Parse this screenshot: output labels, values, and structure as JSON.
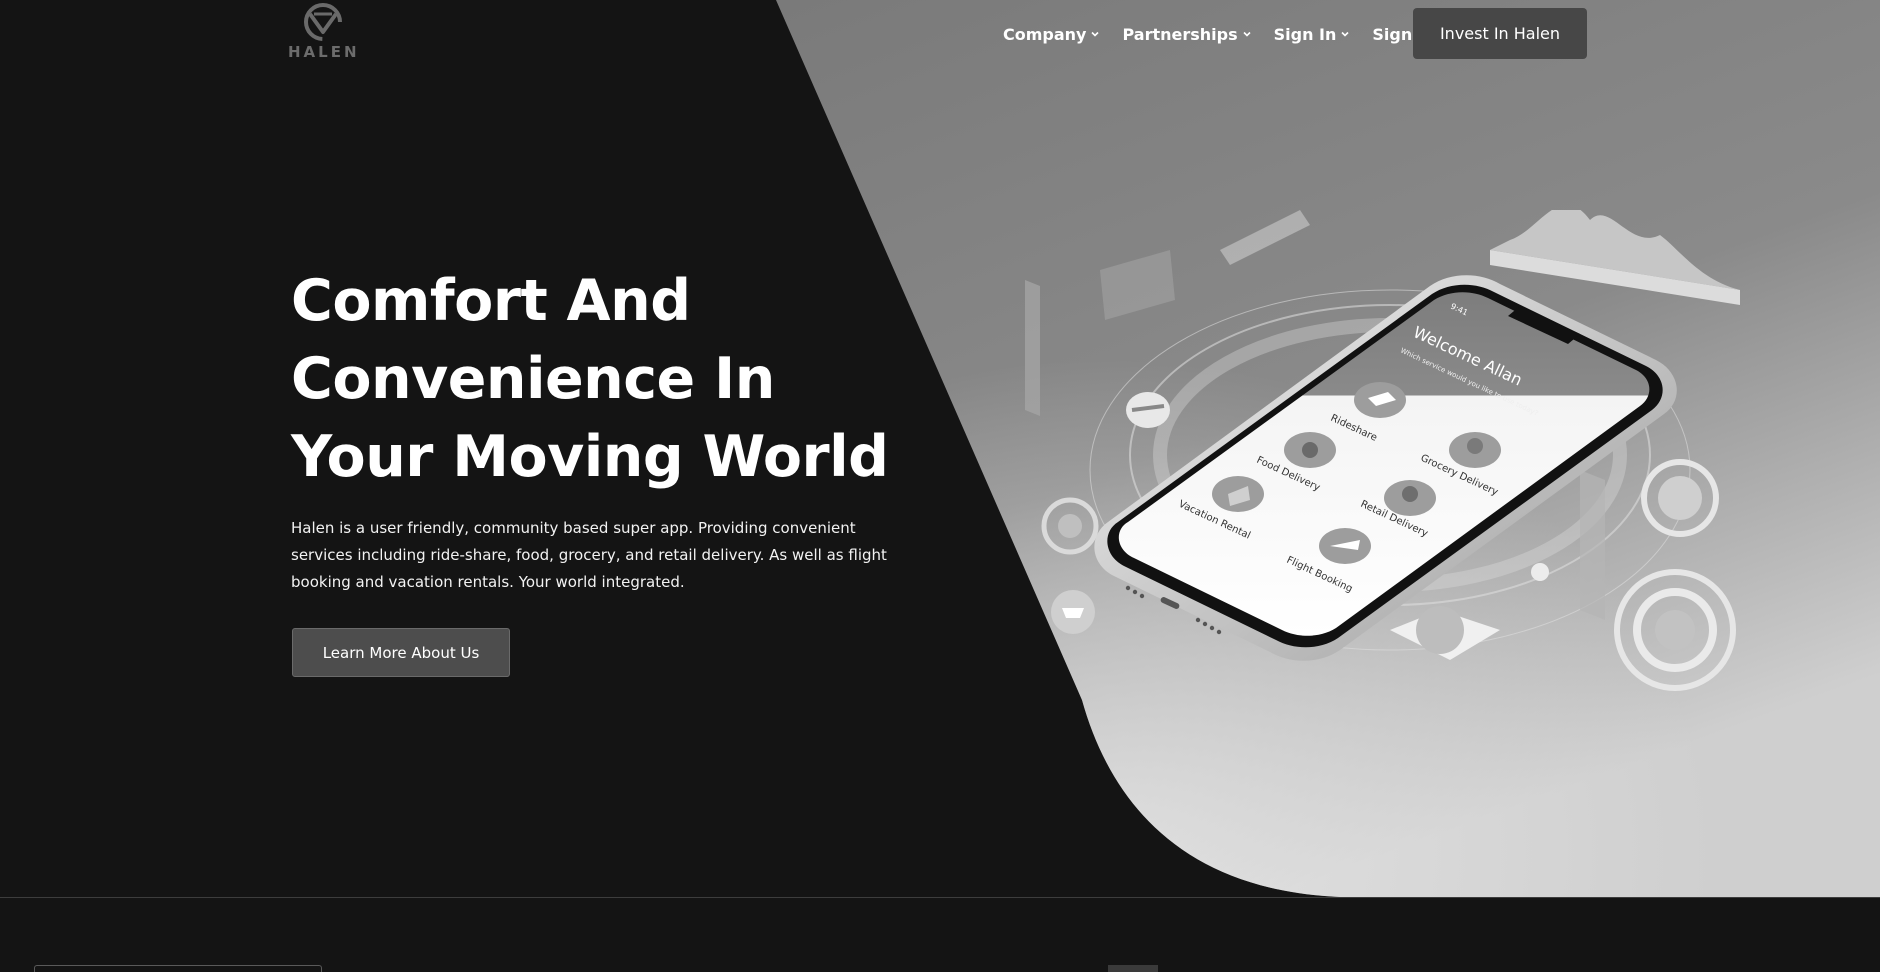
{
  "brand": {
    "logo_text": "HALEN"
  },
  "nav": {
    "items": [
      {
        "label": "Company"
      },
      {
        "label": "Partnerships"
      },
      {
        "label": "Sign In"
      },
      {
        "label": "Sign Up"
      }
    ],
    "cta_label": "Invest In Halen"
  },
  "hero": {
    "title_line1": "Comfort And",
    "title_line2": "Convenience In",
    "title_line3": "Your Moving World",
    "description": "Halen is a user friendly, community based super app. Providing convenient services including ride-share, food, grocery, and retail delivery. As well as flight booking and vacation rentals. Your world integrated.",
    "button_label": "Learn More About Us"
  },
  "phone": {
    "status_time": "9:41",
    "greeting": "Welcome Allan",
    "subtitle": "Which service would you like to use today?",
    "services": [
      {
        "label": "Rideshare"
      },
      {
        "label": "Food Delivery"
      },
      {
        "label": "Grocery Delivery"
      },
      {
        "label": "Vacation Rental"
      },
      {
        "label": "Retail Delivery"
      },
      {
        "label": "Flight Booking"
      }
    ]
  },
  "colors": {
    "background": "#141414",
    "hero_panel_light": "#d9d9d9",
    "hero_panel_dark": "#6e6e6e",
    "button_bg": "#4d4d4d",
    "cta_bg": "#474747",
    "text": "#ffffff"
  }
}
